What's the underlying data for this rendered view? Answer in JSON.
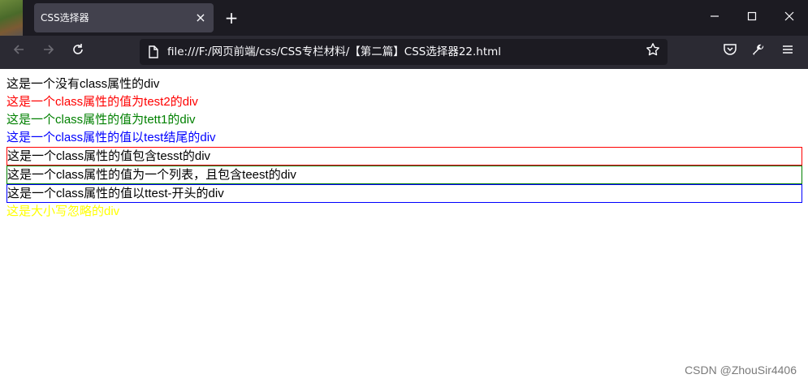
{
  "browser": {
    "tab_title": "CSS选择器",
    "tab_close": "×",
    "new_tab": "+",
    "url": "file:///F:/网页前端/css/CSS专栏材料/【第二篇】CSS选择器22.html",
    "window_buttons": {
      "minimize": "—",
      "maximize": "☐",
      "close": "✕"
    },
    "icons": [
      "back-icon",
      "forward-icon",
      "reload-icon",
      "page-icon",
      "bookmark-star-icon",
      "pocket-icon",
      "wrench-icon",
      "menu-icon"
    ]
  },
  "page": {
    "lines": [
      {
        "text": "这是一个没有class属性的div",
        "color": "#000000",
        "border": null
      },
      {
        "text": "这是一个class属性的值为test2的div",
        "color": "#ff0000",
        "border": null
      },
      {
        "text": "这是一个class属性的值为tett1的div",
        "color": "#008000",
        "border": null
      },
      {
        "text": "这是一个class属性的值以test结尾的div",
        "color": "#0000ff",
        "border": null
      },
      {
        "text": "这是一个class属性的值包含tesst的div",
        "color": "#000000",
        "border": "#ff0000"
      },
      {
        "text": "这是一个class属性的值为一个列表，且包含teest的div",
        "color": "#000000",
        "border": "#008000"
      },
      {
        "text": "这是一个class属性的值以ttest-开头的div",
        "color": "#000000",
        "border": "#0000ff"
      },
      {
        "text": "这是大小写忽略的div",
        "color": "#ffff00",
        "border": null
      }
    ]
  },
  "watermark": "CSDN @ZhouSir4406"
}
